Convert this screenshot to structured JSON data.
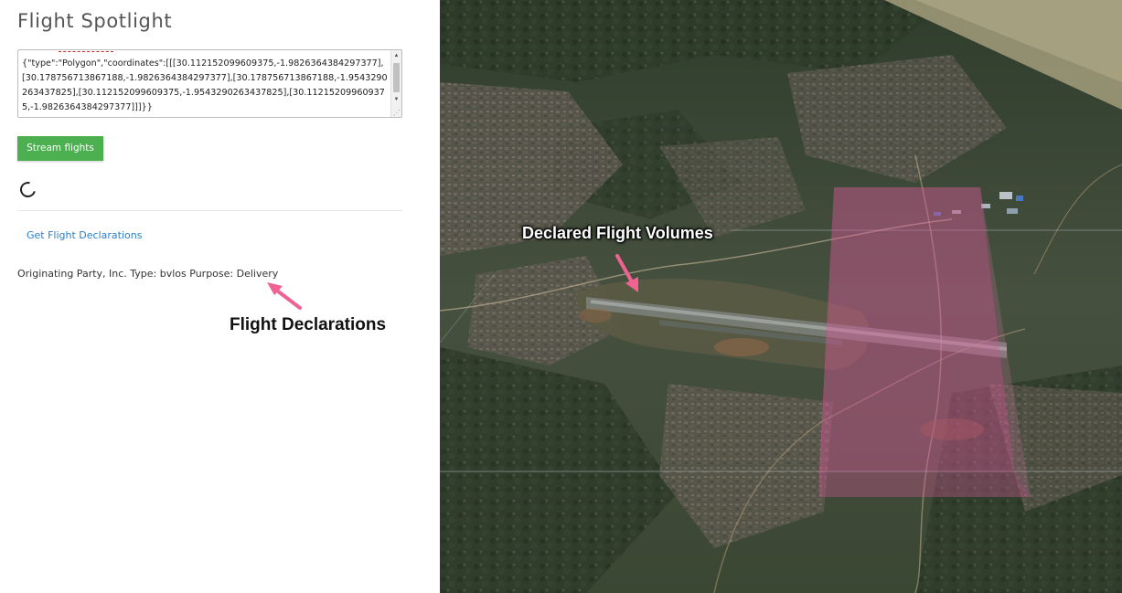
{
  "panel": {
    "title": "Flight Spotlight",
    "geojson_text": "{\"type\":\"Polygon\",\"coordinates\":[[[30.112152099609375,-1.9826364384297377],[30.178756713867188,-1.9826364384297377],[30.178756713867188,-1.9543290263437825],[30.112152099609375,-1.9543290263437825],[30.112152099609375,-1.9826364384297377]]]}}",
    "stream_button_label": "Stream flights",
    "get_declarations_link": "Get Flight Declarations",
    "declaration_line": "Originating Party, Inc. Type: bvlos Purpose: Delivery"
  },
  "annotations": {
    "flight_declarations": "Flight Declarations",
    "declared_volumes": "Declared Flight Volumes"
  },
  "colors": {
    "button": "#4caf50",
    "link": "#2a7fc9",
    "volume_fill": "#d9589a",
    "arrow": "#f06292"
  },
  "icons": {
    "spinner": "loading-spinner-icon",
    "scroll_up": "scroll-up-icon",
    "scroll_down": "scroll-down-icon"
  }
}
